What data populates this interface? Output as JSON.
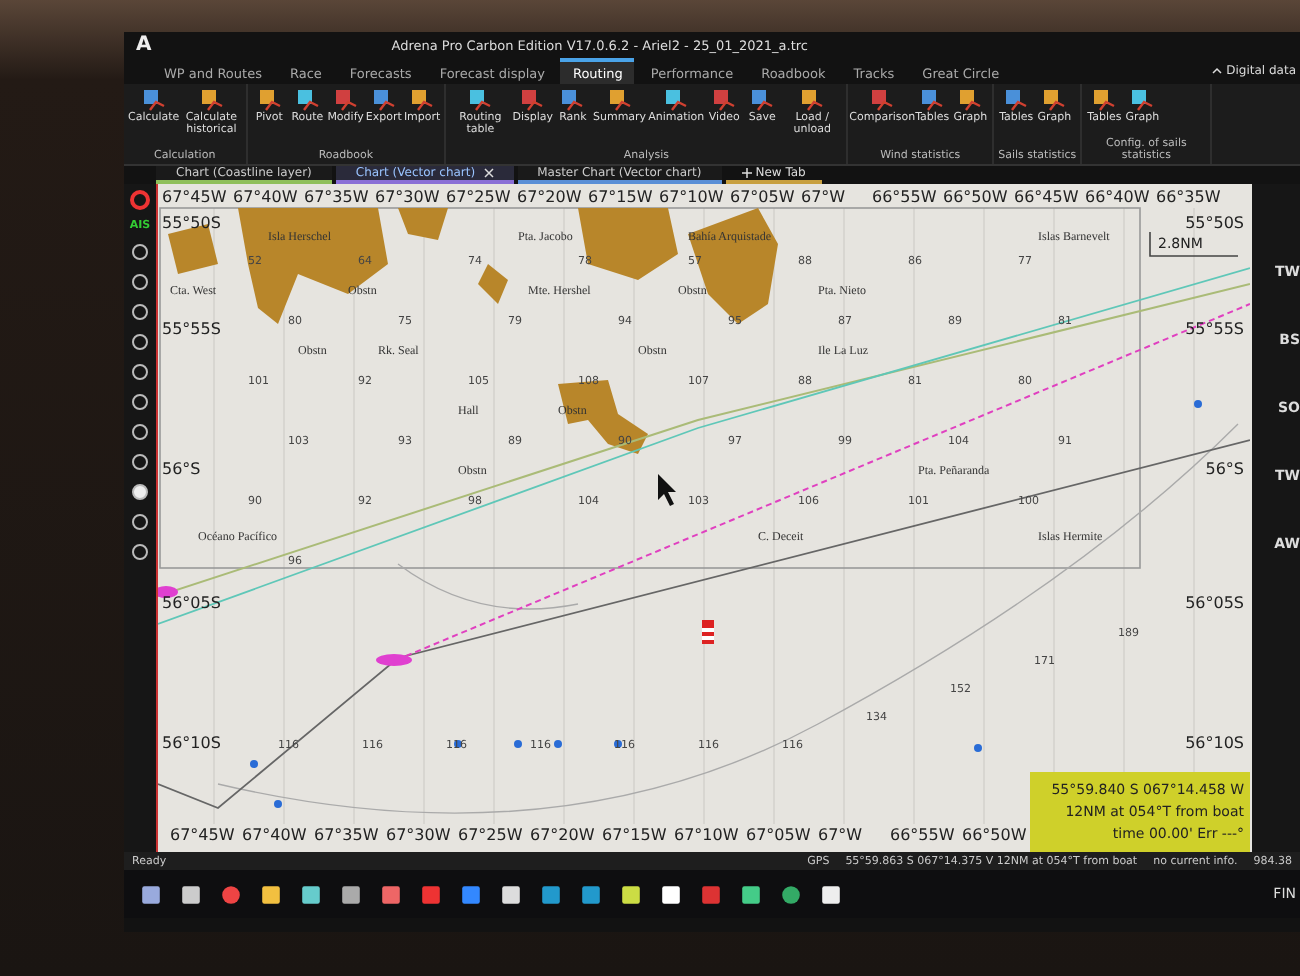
{
  "window": {
    "logo": "A",
    "title": "Adrena Pro Carbon Edition V17.0.6.2 - Ariel2 - 25_01_2021_a.trc"
  },
  "menu_tabs": [
    {
      "label": "WP and Routes",
      "selected": false
    },
    {
      "label": "Race",
      "selected": false
    },
    {
      "label": "Forecasts",
      "selected": false
    },
    {
      "label": "Forecast display",
      "selected": false
    },
    {
      "label": "Routing",
      "selected": true
    },
    {
      "label": "Performance",
      "selected": false
    },
    {
      "label": "Roadbook",
      "selected": false
    },
    {
      "label": "Tracks",
      "selected": false
    },
    {
      "label": "Great Circle",
      "selected": false
    }
  ],
  "digital_data": "Digital data",
  "ribbon_groups": [
    {
      "label": "Calculation",
      "buttons": [
        "Calculate",
        "Calculate historical"
      ]
    },
    {
      "label": "Roadbook",
      "buttons": [
        "Pivot",
        "Route",
        "Modify",
        "Export",
        "Import"
      ]
    },
    {
      "label": "Analysis",
      "buttons": [
        "Routing table",
        "Display",
        "Rank",
        "Summary",
        "Animation",
        "Video",
        "Save",
        "Load / unload"
      ]
    },
    {
      "label": "Wind statistics",
      "buttons": [
        "Comparison",
        "Tables",
        "Graph"
      ]
    },
    {
      "label": "Sails statistics",
      "buttons": [
        "Tables",
        "Graph"
      ]
    },
    {
      "label": "Config. of sails statistics",
      "buttons": [
        "Tables",
        "Graph"
      ]
    }
  ],
  "chart_tabs": [
    {
      "label": "Chart (Coastline layer)",
      "selected": false,
      "color": "#8fbf5a"
    },
    {
      "label": "Chart (Vector chart)",
      "selected": true,
      "color": "#8a6fd6"
    },
    {
      "label": "Master Chart (Vector chart)",
      "selected": false,
      "color": "#5a8fd6"
    }
  ],
  "new_tab": "New Tab",
  "side_label": "AIS",
  "chart": {
    "top_longitudes": [
      "67°45W",
      "67°40W",
      "67°35W",
      "67°30W",
      "67°25W",
      "67°20W",
      "67°15W",
      "67°10W",
      "67°05W",
      "67°W",
      "66°55W",
      "66°50W",
      "66°45W",
      "66°40W",
      "66°35W"
    ],
    "bottom_longitudes": [
      "67°45W",
      "67°40W",
      "67°35W",
      "67°30W",
      "67°25W",
      "67°20W",
      "67°15W",
      "67°10W",
      "67°05W",
      "67°W",
      "66°55W",
      "66°50W"
    ],
    "left_latitudes": [
      "55°50S",
      "55°55S",
      "56°S",
      "56°05S",
      "56°10S"
    ],
    "right_latitudes": [
      "55°50S",
      "55°55S",
      "56°S",
      "56°05S",
      "56°10S"
    ],
    "scale": "2.8NM",
    "place_names": [
      "Cta. West",
      "Isla Herschel",
      "Pta. Jacobo",
      "Mte. Hershel",
      "Bahía Arquistade",
      "Pta. Nieto",
      "Ile La Luz",
      "Pta. Peñaranda",
      "C. Deceit",
      "Islas Hermite",
      "Islas Barnevelt",
      "Rk. Seal",
      "Hall",
      "Océano Pacífico",
      "Obstn",
      "Obstn",
      "Obstn",
      "Obstn",
      "Obstn",
      "Obstn"
    ],
    "soundings": [
      "52",
      "64",
      "74",
      "78",
      "57",
      "88",
      "86",
      "77",
      "80",
      "75",
      "79",
      "94",
      "95",
      "87",
      "89",
      "81",
      "101",
      "92",
      "105",
      "108",
      "107",
      "88",
      "81",
      "80",
      "103",
      "93",
      "89",
      "90",
      "97",
      "99",
      "104",
      "91",
      "90",
      "92",
      "98",
      "104",
      "103",
      "106",
      "101",
      "100",
      "96",
      "116",
      "116",
      "116",
      "116",
      "116",
      "116",
      "116",
      "134",
      "152",
      "171",
      "189"
    ],
    "cursor_info": [
      "55°59.840 S  067°14.458 W",
      "12NM at 054°T from boat",
      "time 00.00' Err ---°"
    ]
  },
  "right_panel": [
    "TW",
    "BS",
    "SO",
    "TW",
    "AW"
  ],
  "status": {
    "left": "Ready",
    "gps": "GPS",
    "position": "55°59.863 S  067°14.375 V 12NM at 054°T from boat",
    "info": "no current info.",
    "value": "984.38"
  },
  "tray_language": "FIN"
}
